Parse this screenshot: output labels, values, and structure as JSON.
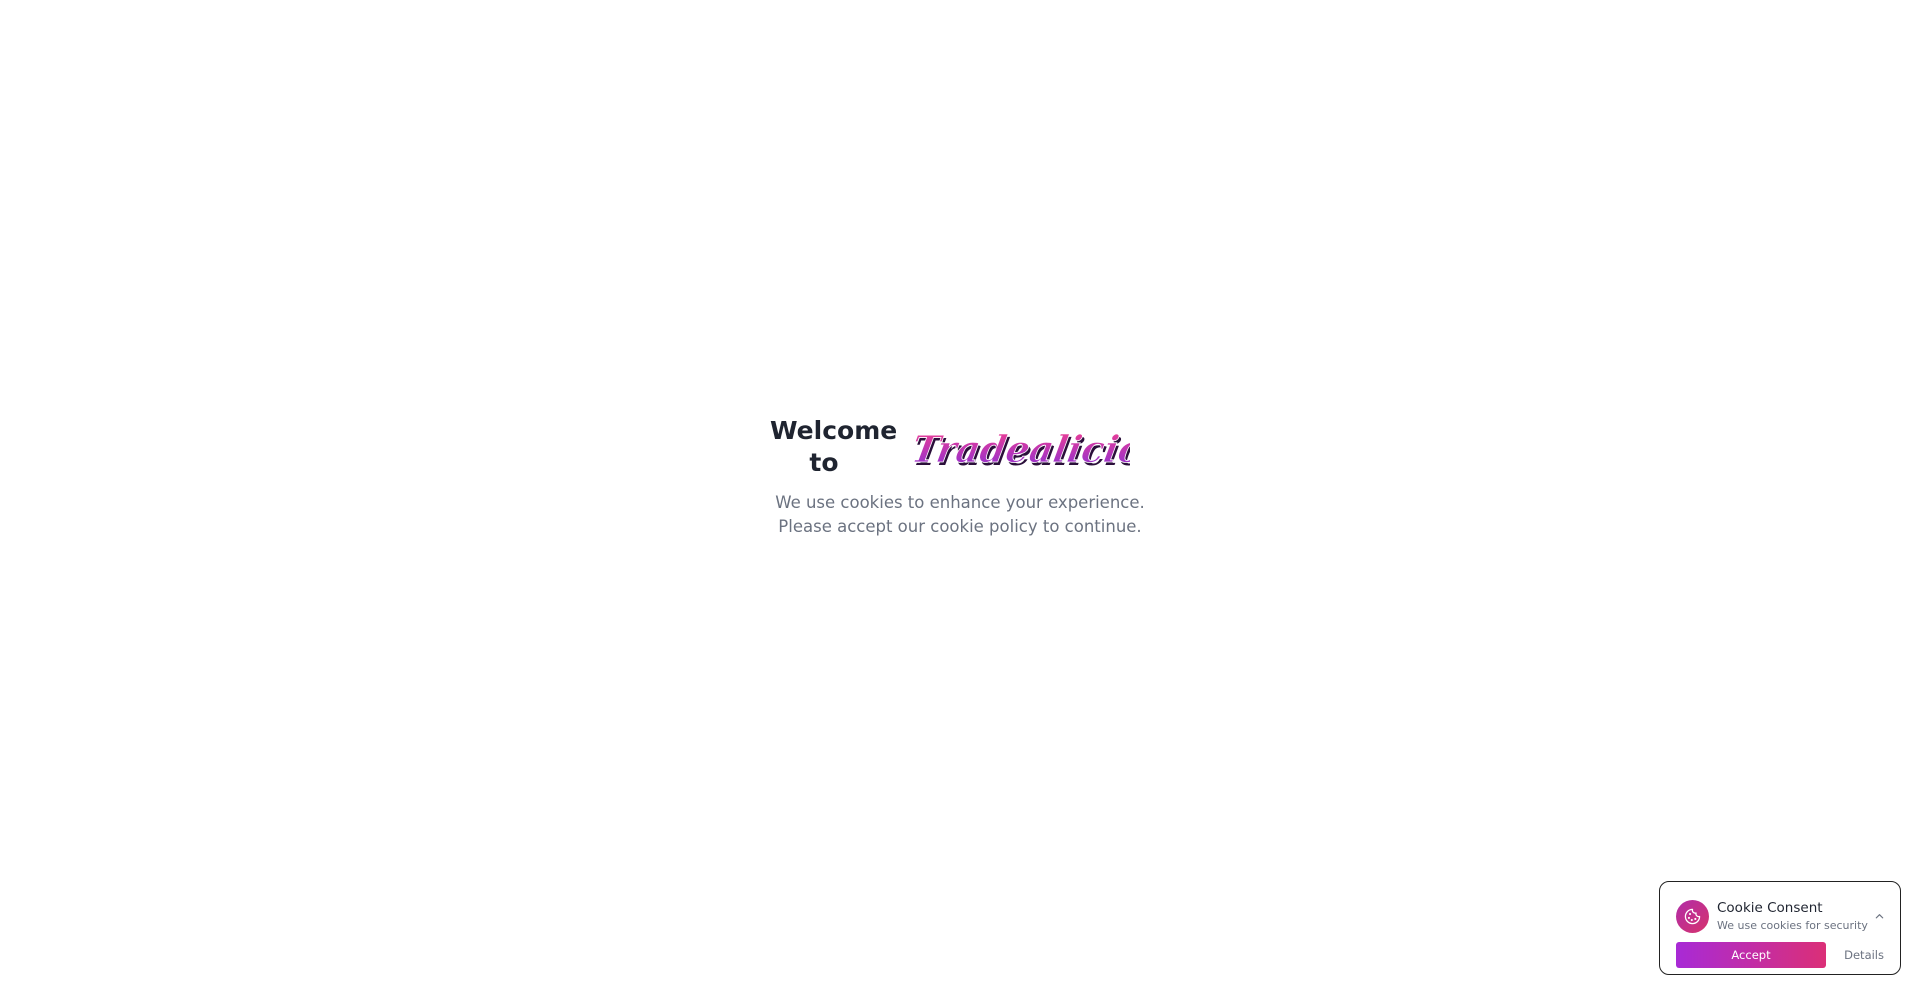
{
  "hero": {
    "welcome_line1": "Welcome",
    "welcome_line2": "to",
    "logo_text": "Tradealicious",
    "subtitle": "We use cookies to enhance your experience. Please accept our cookie policy to continue."
  },
  "cookie_banner": {
    "icon": "cookie-icon",
    "title": "Cookie Consent",
    "subtitle": "We use cookies for security",
    "toggle_icon": "chevron-up-icon",
    "accept_label": "Accept",
    "details_label": "Details"
  },
  "colors": {
    "brand_pink": "#e0338f",
    "brand_purple": "#8a2fd6",
    "accept_gradient_start": "#a82ad6",
    "accept_gradient_end": "#db2f77",
    "heading": "#1f2430",
    "muted_text": "#6b7280"
  }
}
